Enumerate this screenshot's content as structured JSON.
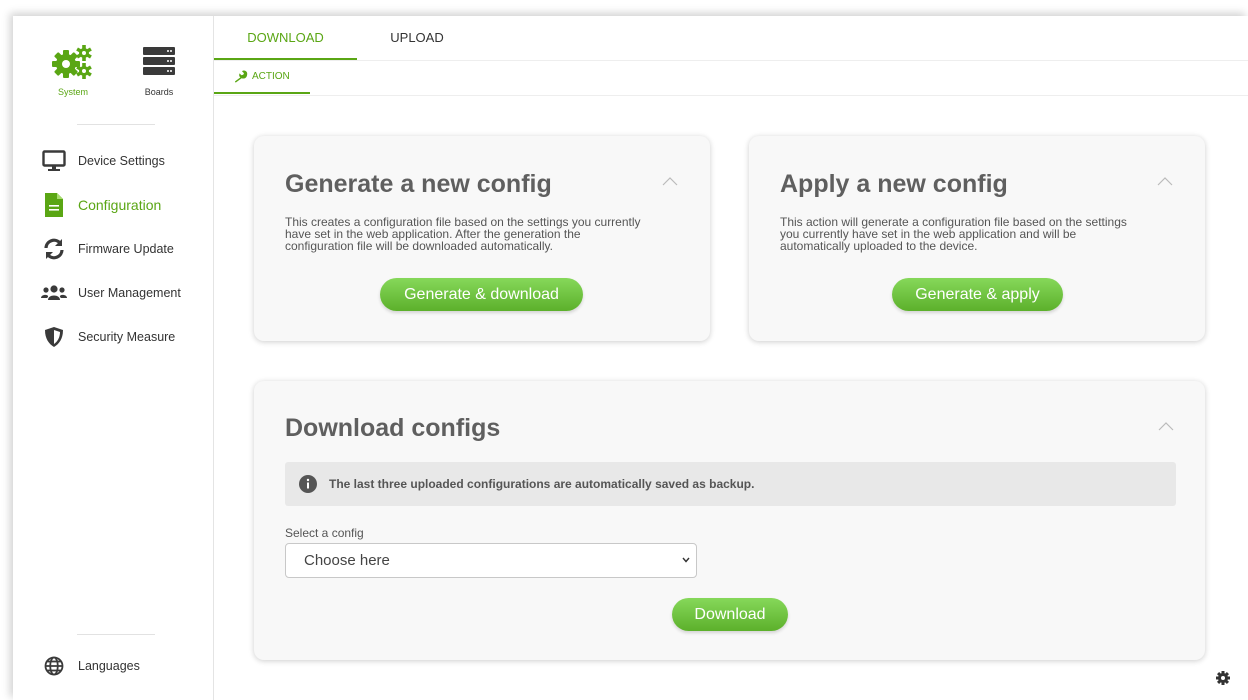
{
  "sidebar": {
    "top": {
      "system_label": "System",
      "boards_label": "Boards"
    },
    "items": [
      {
        "label": "Device Settings",
        "icon": "monitor-icon"
      },
      {
        "label": "Configuration",
        "icon": "document-icon"
      },
      {
        "label": "Firmware Update",
        "icon": "sync-icon"
      },
      {
        "label": "User Management",
        "icon": "users-icon"
      },
      {
        "label": "Security Measure",
        "icon": "shield-icon"
      }
    ],
    "languages_label": "Languages"
  },
  "tabs": {
    "download": "DOWNLOAD",
    "upload": "UPLOAD"
  },
  "subtab": {
    "action": "ACTION"
  },
  "cards": {
    "generate": {
      "title": "Generate a new config",
      "text_line1": "This creates a configuration file based on the settings you currently",
      "text_line2": "have set in the web application. After the generation the",
      "text_line3": "configuration file will be downloaded automatically.",
      "button": "Generate & download"
    },
    "apply": {
      "title": "Apply a new config",
      "text_line1": "This action will generate a configuration file based on the settings",
      "text_line2": "you currently have set in the web application and will be",
      "text_line3": "automatically uploaded to the device.",
      "button": "Generate & apply"
    },
    "download": {
      "title": "Download configs",
      "info": "The last three uploaded configurations are automatically saved as backup.",
      "select_label": "Select a config",
      "select_value": "Choose here",
      "button": "Download"
    }
  },
  "colors": {
    "accent": "#5aa614",
    "button_top": "#86d85a",
    "button_bottom": "#5cb02b"
  }
}
